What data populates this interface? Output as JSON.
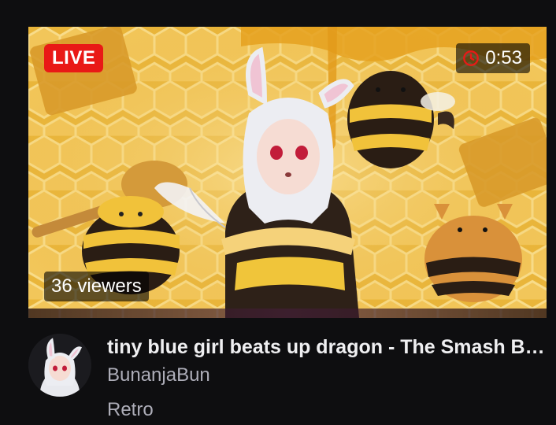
{
  "stream": {
    "live_label": "LIVE",
    "uptime": "0:53",
    "viewers": "36 viewers",
    "title": "tiny blue girl beats up dragon - The Smash Bros",
    "channel": "BunanjaBun",
    "category": "Retro"
  },
  "icons": {
    "uptime": "clock-icon"
  },
  "colors": {
    "background": "#0e0e10",
    "live_badge": "#e91916",
    "title_text": "#efeff1",
    "secondary_text": "#adadb8",
    "honey": "#e9b53a"
  }
}
